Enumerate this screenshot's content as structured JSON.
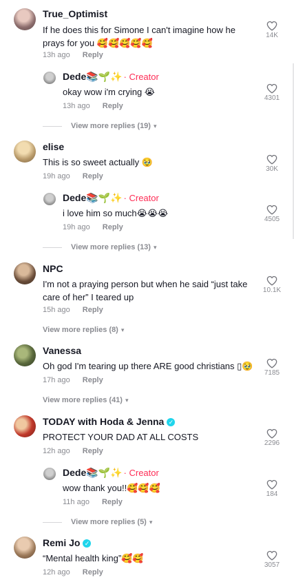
{
  "comments": [
    {
      "username": "True_Optimist",
      "text": "If he does this for Simone I can't imagine how he prays for you 🥰🥰🥰🥰🥰",
      "time": "13h ago",
      "reply": "Reply",
      "likes": "14K",
      "avatar_color": "#8d6e6e",
      "creator_reply": {
        "username": "Dede📚🌱✨",
        "badge": "· Creator",
        "text": "okay wow i'm crying 😭",
        "time": "13h ago",
        "reply": "Reply",
        "likes": "4301"
      },
      "view_more": "View more replies (19)"
    },
    {
      "username": "elise",
      "text": "This is so sweet actually 🥹",
      "time": "19h ago",
      "reply": "Reply",
      "likes": "30K",
      "avatar_color": "#b89a6a",
      "creator_reply": {
        "username": "Dede📚🌱✨",
        "badge": "· Creator",
        "text": "i love him so much😭😭😭",
        "time": "19h ago",
        "reply": "Reply",
        "likes": "4505"
      },
      "view_more": "View more replies (13)"
    },
    {
      "username": "NPC",
      "text": "I'm not a praying person but when he said “just take care of her” I teared up",
      "time": "15h ago",
      "reply": "Reply",
      "likes": "10.1K",
      "avatar_color": "#6b4e3a",
      "view_more": "View more replies (8)"
    },
    {
      "username": "Vanessa",
      "text": "Oh god I'm tearing up there ARE good christians ▯🥹",
      "time": "17h ago",
      "reply": "Reply",
      "likes": "7185",
      "avatar_color": "#5b6a3d",
      "view_more": "View more replies (41)"
    },
    {
      "username": "TODAY with Hoda & Jenna",
      "text": "PROTECT YOUR DAD AT ALL COSTS",
      "time": "12h ago",
      "reply": "Reply",
      "likes": "2296",
      "avatar_color": "#c0392b",
      "creator_reply": {
        "username": "Dede📚🌱✨",
        "badge": "· Creator",
        "text": "wow thank you!!🥰🥰🥰",
        "time": "11h ago",
        "reply": "Reply",
        "likes": "184"
      },
      "view_more": "View more replies (5)"
    },
    {
      "username": "Remi Jo",
      "text": "“Mental health king”🥰🥰",
      "time": "12h ago",
      "reply": "Reply",
      "likes": "3057",
      "avatar_color": "#9c7a5a"
    }
  ],
  "colors": {
    "creator_badge": "#fe2c55",
    "verified": "#20d5ec",
    "muted": "#8a8b91"
  },
  "icons": {
    "like": "heart-outline-icon",
    "verified": "verified-check-icon",
    "expand": "chevron-down-icon"
  }
}
